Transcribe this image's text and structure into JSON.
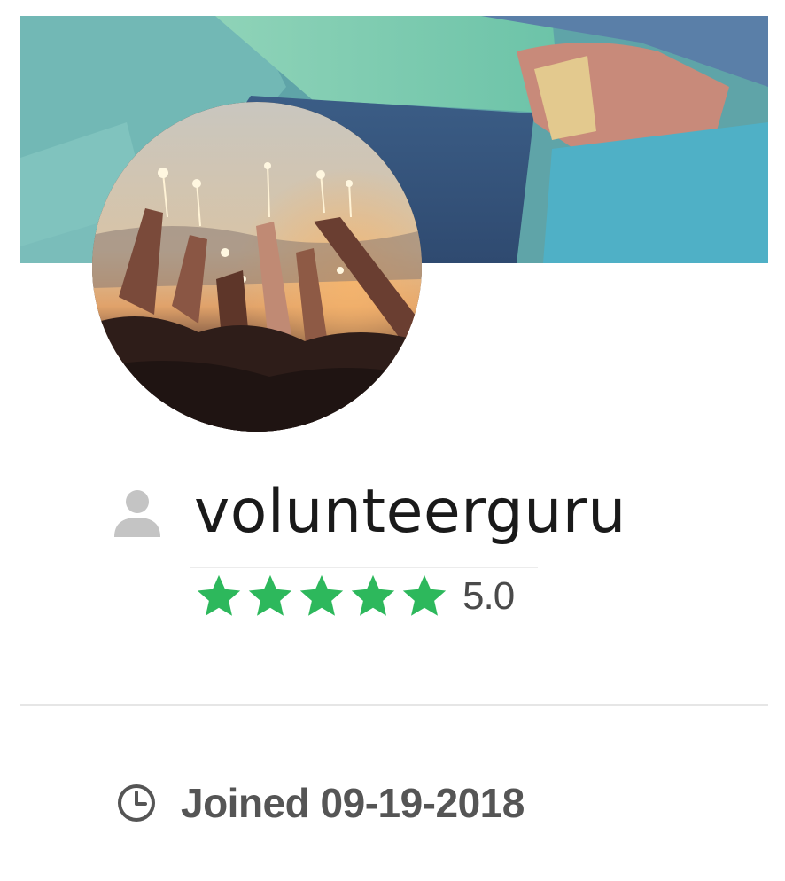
{
  "profile": {
    "username": "volunteerguru",
    "rating": {
      "stars": 5,
      "max_stars": 5,
      "value": "5.0",
      "star_color": "#2db85c"
    },
    "joined": "Joined 09-19-2018"
  },
  "icons": {
    "user": "user-icon",
    "clock": "clock-icon",
    "star": "star-icon"
  },
  "colors": {
    "text_primary": "#1a1a1a",
    "text_secondary": "#555555",
    "icon_gray": "#c4c4c4",
    "divider": "#e6e6e6"
  }
}
